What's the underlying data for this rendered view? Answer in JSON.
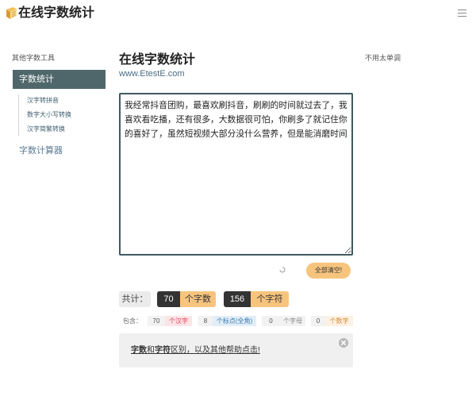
{
  "header": {
    "logo_text": "在线字数统计",
    "logo_icon": "book-icon",
    "menu_icon": "hamburger-menu-icon"
  },
  "sidebar": {
    "heading": "其他字数工具",
    "active_item": "字数统计",
    "sub_items": [
      {
        "label": "汉字转拼音"
      },
      {
        "label": "数字大小写转换"
      },
      {
        "label": "汉字简繁转换"
      }
    ],
    "calculator_item": "字数计算器"
  },
  "main": {
    "title": "在线字数统计",
    "site_url": "www.EtestE.com",
    "textarea": {
      "value": "我经常抖音团购，最喜欢刷抖音，刷刷的时间就过去了，我喜欢看吃播，还有很多，大数据很可怕，你刷多了就记住你的喜好了，虽然短视频大部分没什么营养，但是能消磨时间"
    },
    "loading_icon": "spinner-icon",
    "clear_button_label": "全部清空!",
    "totals": {
      "label": "共计：",
      "word_count": "70",
      "word_unit": "个字数",
      "char_count": "156",
      "char_unit": "个字符"
    },
    "breakdown": {
      "label": "包含：",
      "items": [
        {
          "value": "70",
          "unit": "个汉字"
        },
        {
          "value": "8",
          "unit": "个标点(全角)"
        },
        {
          "value": "0",
          "unit": "个字母"
        },
        {
          "value": "0",
          "unit": "个数字"
        }
      ]
    },
    "help_box": {
      "part1": "字数",
      "part2": "和",
      "part3": "字符",
      "part4": "区别，以及其他帮助点击!",
      "close_icon": "close-circle-icon"
    }
  },
  "right_panel": {
    "note": "不用太单调"
  },
  "colors": {
    "sidebar-active-bg": "#4f676b",
    "accent-orange": "#f7c47e",
    "badge-dark": "#333333",
    "hanzi-text": "#d9435b",
    "punct-text": "#3a78b0",
    "digit-text": "#d08b3a",
    "textarea-border": "#3e5a5f"
  }
}
